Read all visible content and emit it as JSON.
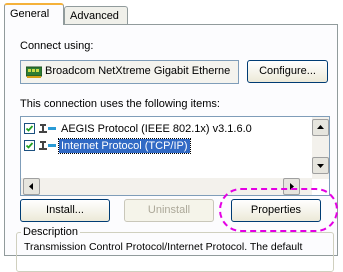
{
  "tabs": [
    {
      "label": "General",
      "active": true
    },
    {
      "label": "Advanced",
      "active": false
    }
  ],
  "connect_using_label": "Connect using:",
  "adapter": {
    "icon": "network-adapter-icon",
    "name": "Broadcom NetXtreme Gigabit Etherne"
  },
  "configure_button": "Configure...",
  "items_label": "This connection uses the following items:",
  "items": [
    {
      "label": "AEGIS Protocol (IEEE 802.1x) v3.1.6.0",
      "checked": true,
      "selected": false
    },
    {
      "label": "Internet Protocol (TCP/IP)",
      "checked": true,
      "selected": true
    }
  ],
  "buttons": {
    "install": "Install...",
    "uninstall": "Uninstall",
    "properties": "Properties"
  },
  "description": {
    "title": "Description",
    "text": "Transmission Control Protocol/Internet Protocol. The default"
  },
  "colors": {
    "selection": "#316ac5",
    "highlight_annotation": "#e400e4",
    "tab_accent": "#f5b23b"
  }
}
